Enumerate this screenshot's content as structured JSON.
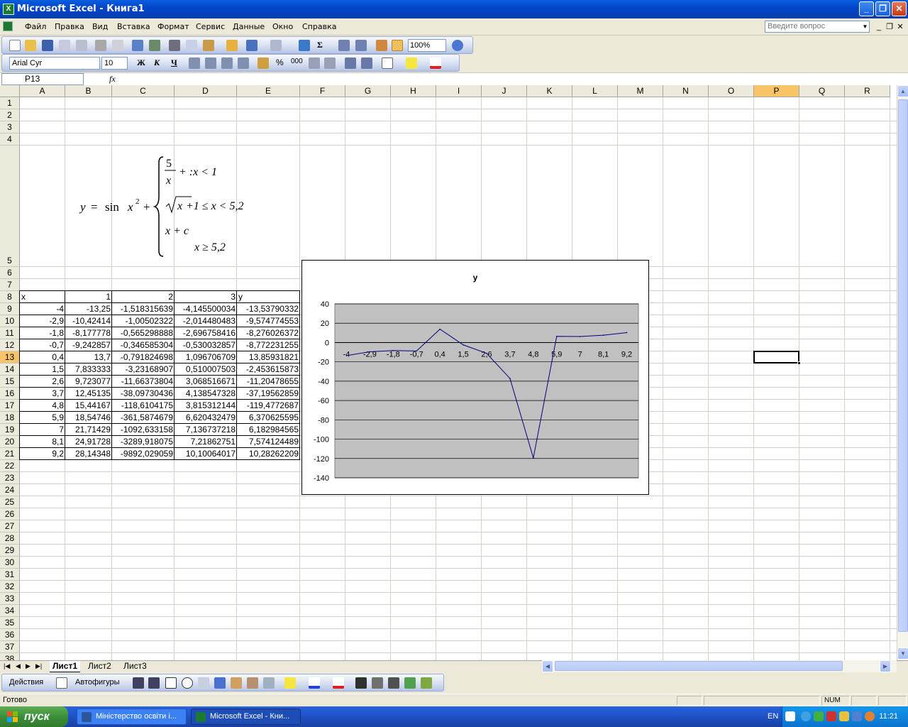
{
  "window": {
    "title": "Microsoft Excel - Книга1"
  },
  "menu": {
    "items": [
      "Файл",
      "Правка",
      "Вид",
      "Вставка",
      "Формат",
      "Сервис",
      "Данные",
      "Окно",
      "Справка"
    ],
    "ask_placeholder": "Введите вопрос"
  },
  "toolbar": {
    "zoom": "100%",
    "font_name": "Arial Cyr",
    "font_size": "10",
    "bold": "Ж",
    "italic": "К",
    "underline": "Ч",
    "percent": "%",
    "thousands": "000",
    "sigma": "Σ"
  },
  "formula_bar": {
    "name_box": "P13",
    "fx": "fx",
    "value": ""
  },
  "columns": [
    "A",
    "B",
    "C",
    "D",
    "E",
    "F",
    "G",
    "H",
    "I",
    "J",
    "K",
    "L",
    "M",
    "N",
    "O",
    "P",
    "Q",
    "R"
  ],
  "active_column": "P",
  "active_row": "13",
  "rows": [
    "1",
    "2",
    "3",
    "4",
    "5",
    "6",
    "7",
    "8",
    "9",
    "10",
    "11",
    "12",
    "13",
    "14",
    "15",
    "16",
    "17",
    "18",
    "19",
    "20",
    "21",
    "22",
    "23",
    "24",
    "25",
    "26",
    "27",
    "28",
    "29",
    "30",
    "31",
    "32",
    "33",
    "34",
    "35",
    "36",
    "37",
    "38"
  ],
  "formula": {
    "lhs": "y",
    "eq": "=",
    "sin": "sin",
    "x2": "x",
    "sup2": "2",
    "plus": "+",
    "case1_num": "5",
    "case1_den": "x",
    "case1_tail": "+ :x < 1",
    "case2_root": "x",
    "case2_tail": "+1 ≤ x < 5,2",
    "case3": "x + c",
    "case3_cond": "x ≥ 5,2"
  },
  "table": {
    "headers": [
      "x",
      "1",
      "2",
      "3",
      "y"
    ],
    "rows": [
      [
        "-4",
        "-13,25",
        "-1,518315639",
        "-4,145500034",
        "-13,53790332"
      ],
      [
        "-2,9",
        "-10,42414",
        "-1,00502322",
        "-2,014480483",
        "-9,574774553"
      ],
      [
        "-1,8",
        "-8,177778",
        "-0,565298888",
        "-2,696758416",
        "-8,276026372"
      ],
      [
        "-0,7",
        "-9,242857",
        "-0,346585304",
        "-0,530032857",
        "-8,772231255"
      ],
      [
        "0,4",
        "13,7",
        "-0,791824698",
        "1,096706709",
        "13,85931821"
      ],
      [
        "1,5",
        "7,833333",
        "-3,23168907",
        "0,510007503",
        "-2,453615873"
      ],
      [
        "2,6",
        "9,723077",
        "-11,66373804",
        "3,068516671",
        "-11,20478655"
      ],
      [
        "3,7",
        "12,45135",
        "-38,09730436",
        "4,138547328",
        "-37,19562859"
      ],
      [
        "4,8",
        "15,44167",
        "-118,6104175",
        "3,815312144",
        "-119,4772687"
      ],
      [
        "5,9",
        "18,54746",
        "-361,5874679",
        "6,620432479",
        "6,370625595"
      ],
      [
        "7",
        "21,71429",
        "-1092,633158",
        "7,136737218",
        "6,182984565"
      ],
      [
        "8,1",
        "24,91728",
        "-3289,918075",
        "7,21862751",
        "7,574124489"
      ],
      [
        "9,2",
        "28,14348",
        "-9892,029059",
        "10,10064017",
        "10,28262209"
      ]
    ]
  },
  "chart_data": {
    "type": "line",
    "title": "y",
    "categories": [
      "-4",
      "-2,9",
      "-1,8",
      "-0,7",
      "0,4",
      "1,5",
      "2,6",
      "3,7",
      "4,8",
      "5,9",
      "7",
      "8,1",
      "9,2"
    ],
    "series": [
      {
        "values": [
          -13.54,
          -9.57,
          -8.28,
          -8.77,
          13.86,
          -2.45,
          -11.2,
          -37.2,
          -119.48,
          6.37,
          6.18,
          7.57,
          10.28
        ],
        "color": "#000080"
      }
    ],
    "y_ticks": [
      "40",
      "20",
      "0",
      "-20",
      "-40",
      "-60",
      "-80",
      "-100",
      "-120",
      "-140"
    ],
    "ylim": [
      -140,
      40
    ],
    "plot_area_color": "#C0C0C0",
    "grid": true,
    "xlabel": "",
    "ylabel": ""
  },
  "sheet_tabs": [
    "Лист1",
    "Лист2",
    "Лист3"
  ],
  "drawing_toolbar": {
    "actions": "Действия",
    "autoshapes": "Автофигуры"
  },
  "status": {
    "text": "Готово",
    "num": "NUM"
  },
  "taskbar": {
    "start": "пуск",
    "tasks": [
      "Міністерство освіти і...",
      "Microsoft Excel - Кни..."
    ],
    "lang": "EN",
    "time": "11:21"
  }
}
